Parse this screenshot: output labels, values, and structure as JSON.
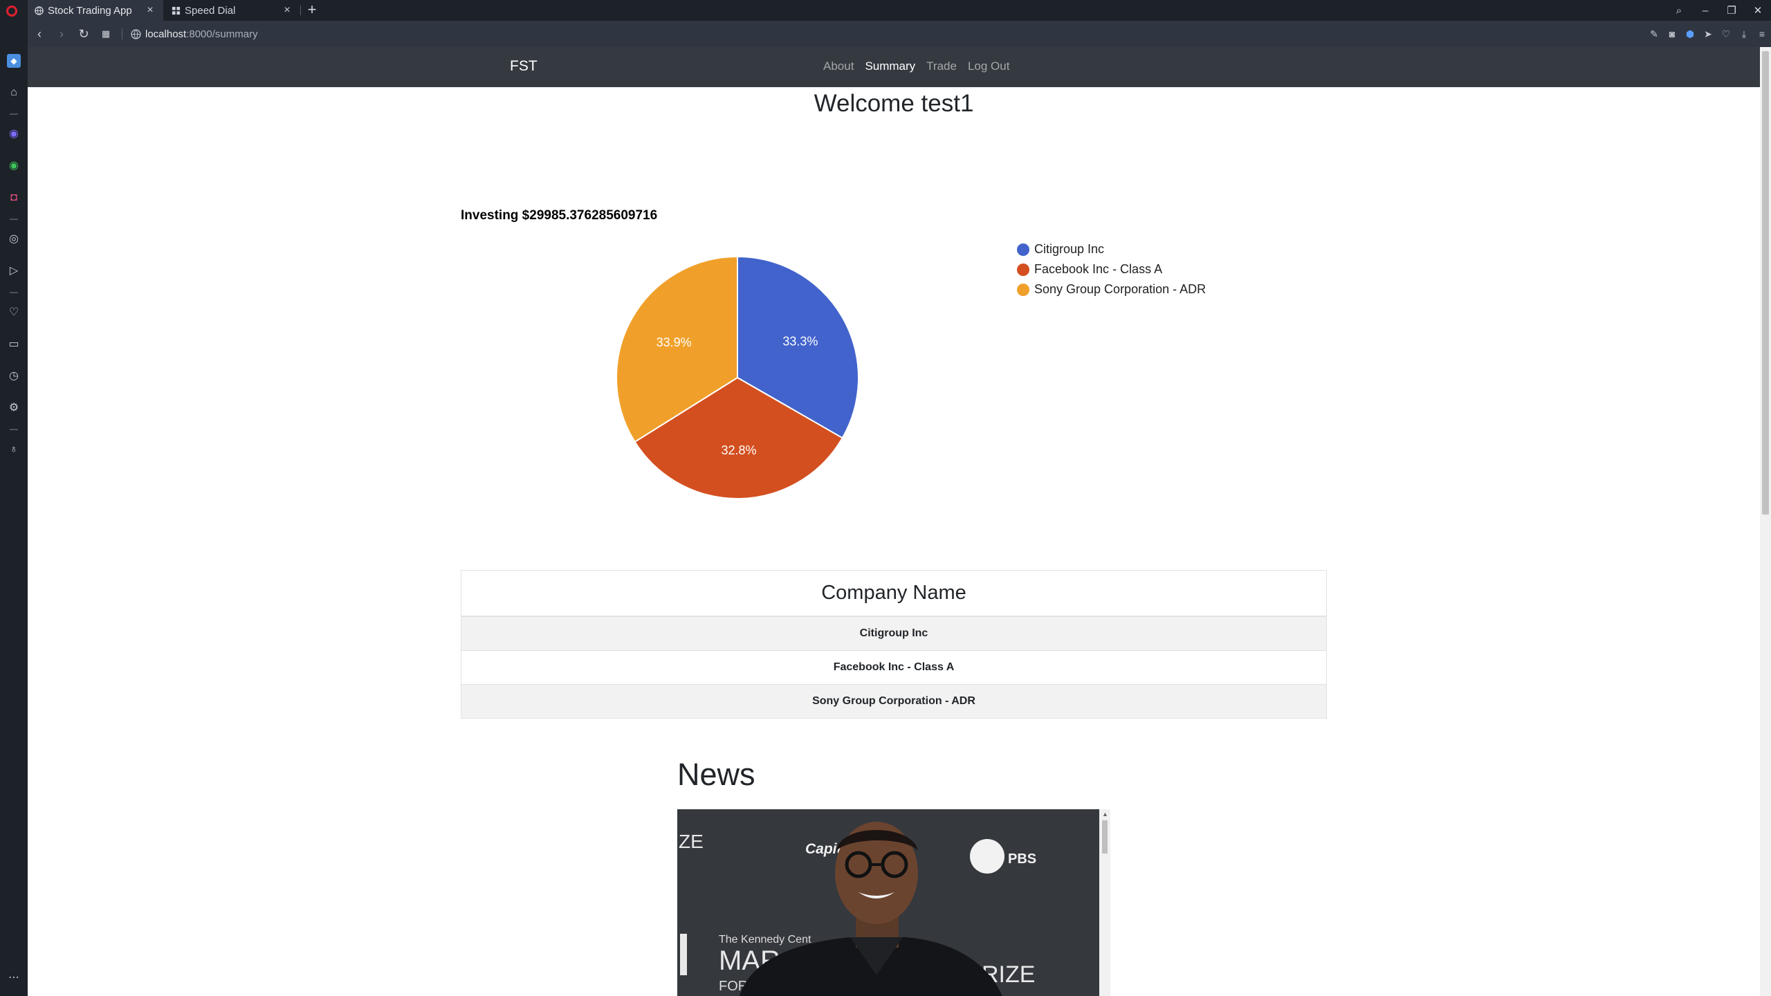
{
  "browser": {
    "tabs": [
      {
        "title": "Stock Trading App",
        "active": true
      },
      {
        "title": "Speed Dial",
        "active": false
      }
    ],
    "url_host": "localhost",
    "url_path": ":8000/summary"
  },
  "navbar": {
    "brand": "FST",
    "links": [
      "About",
      "Summary",
      "Trade",
      "Log Out"
    ],
    "active": "Summary"
  },
  "welcome": "Welcome test1",
  "investing": "Investing $29985.376285609716",
  "chart_data": {
    "type": "pie",
    "categories": [
      "Citigroup Inc",
      "Facebook Inc - Class A",
      "Sony Group Corporation - ADR"
    ],
    "values": [
      33.3,
      32.8,
      33.9
    ],
    "labels": [
      "33.3%",
      "32.8%",
      "33.9%"
    ],
    "colors": [
      "#4263cc",
      "#d34f1f",
      "#f0a02a"
    ],
    "legend": "right"
  },
  "table": {
    "header": "Company Name",
    "rows": [
      "Citigroup Inc",
      "Facebook Inc - Class A",
      "Sony Group Corporation - ADR"
    ]
  },
  "news": {
    "heading": "News",
    "image_text": {
      "sponsor": "Capital",
      "broadcaster": "PBS",
      "event_line1": "The Kennedy Cent",
      "event_line2": "MAR",
      "event_line3": "FOR",
      "prize_left": "ZE",
      "prize_right": "RIZE"
    }
  }
}
